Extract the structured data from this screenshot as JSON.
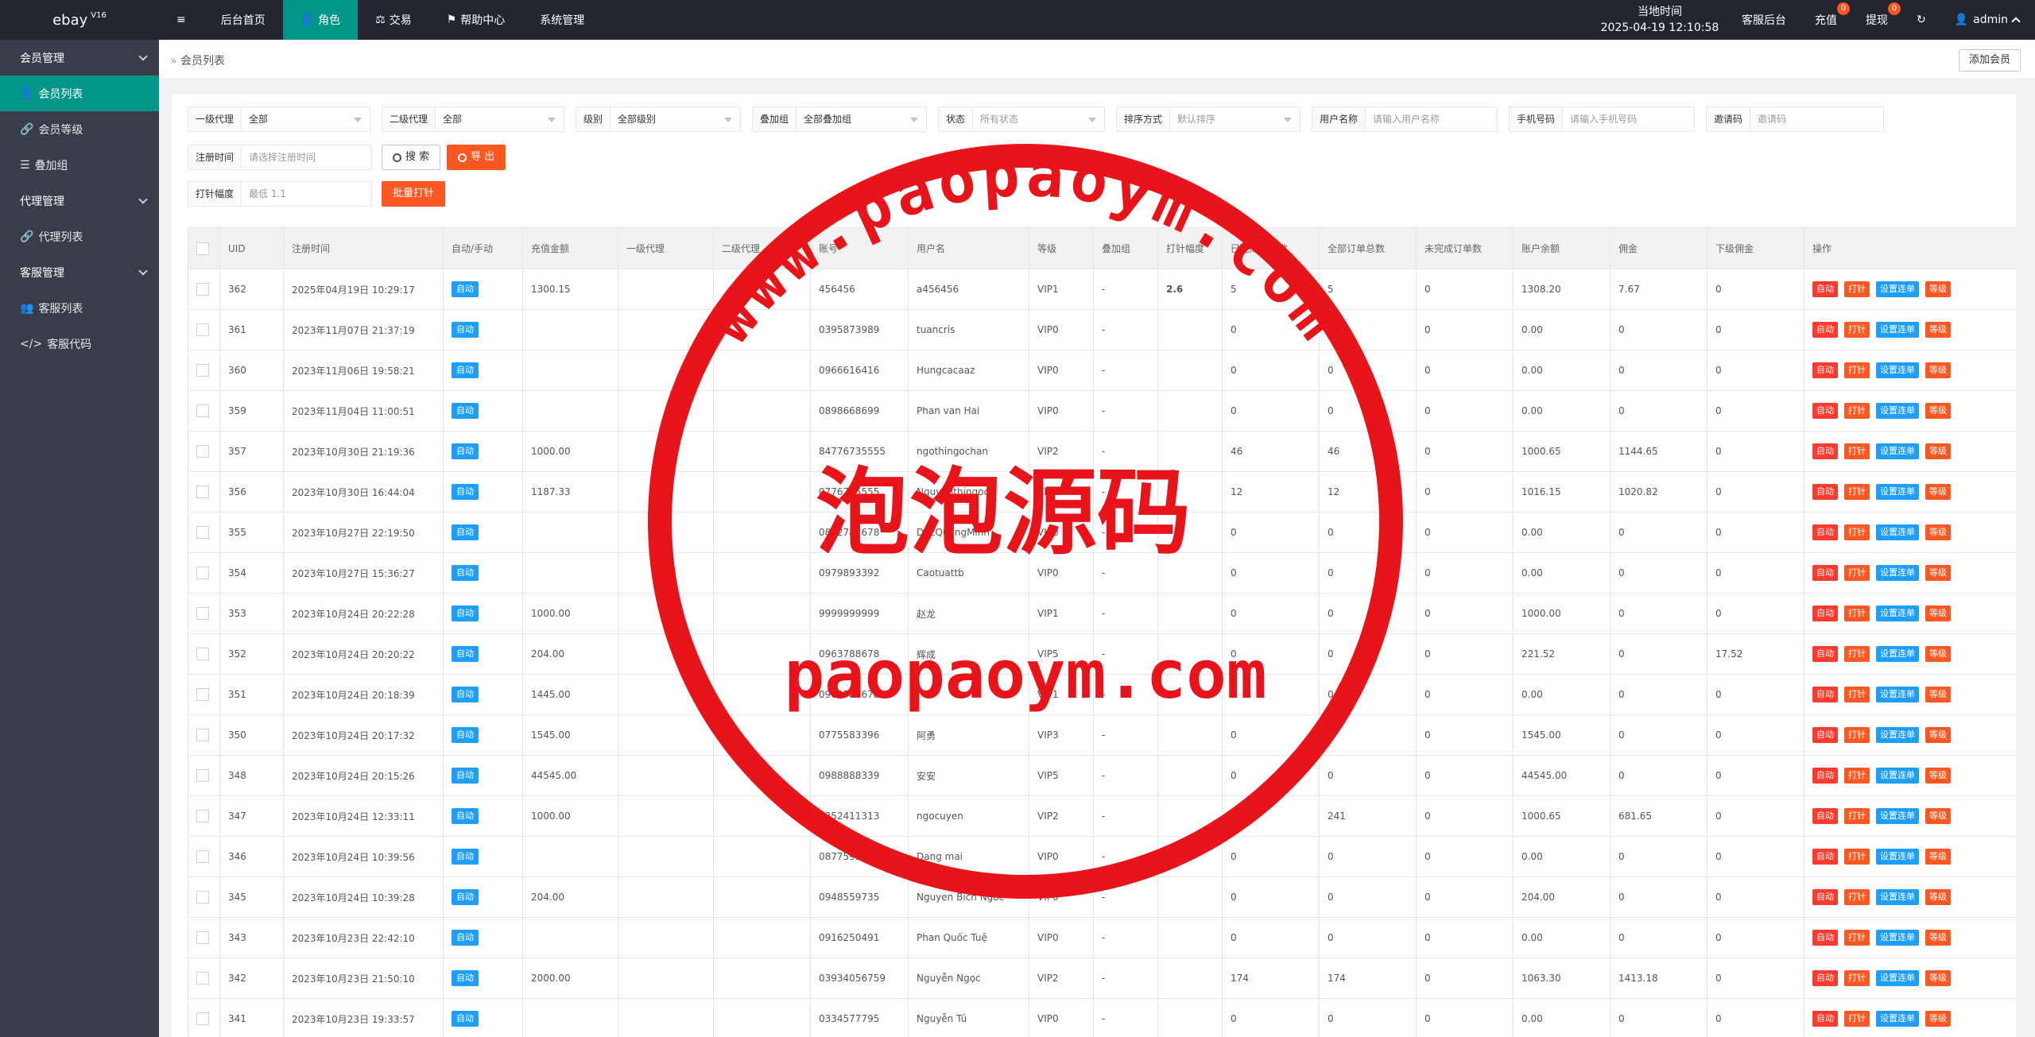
{
  "topbar": {
    "brand": "ebay",
    "brand_version": "V16",
    "menu_toggle_icon": "≡",
    "nav": [
      {
        "label": "后台首页",
        "icon": ""
      },
      {
        "label": "角色",
        "icon": "👤"
      },
      {
        "label": "交易",
        "icon": "⚖"
      },
      {
        "label": "帮助中心",
        "icon": "⚑"
      },
      {
        "label": "系统管理",
        "icon": ""
      }
    ],
    "clock_label": "当地时间",
    "clock_value": "2025-04-19 12:10:58",
    "service_backend": "客服后台",
    "recharge": "充值",
    "recharge_count": "0",
    "withdraw": "提现",
    "withdraw_count": "0",
    "refresh_icon": "↻",
    "user": "admin"
  },
  "sidebar": {
    "groups": [
      {
        "label": "会员管理",
        "items": [
          {
            "label": "会员列表",
            "icon": "👤",
            "active": true
          },
          {
            "label": "会员等级",
            "icon": "🔗"
          },
          {
            "label": "叠加组",
            "icon": "☰"
          }
        ]
      },
      {
        "label": "代理管理",
        "items": [
          {
            "label": "代理列表",
            "icon": "🔗"
          }
        ]
      },
      {
        "label": "客服管理",
        "items": [
          {
            "label": "客服列表",
            "icon": "👥"
          },
          {
            "label": "客服代码",
            "icon": "</>"
          }
        ]
      }
    ]
  },
  "tabbar": {
    "breadcrumb": "会员列表",
    "add_button": "添加会员"
  },
  "filters": {
    "agent1": {
      "label": "一级代理",
      "value": "全部"
    },
    "agent2": {
      "label": "二级代理",
      "value": "全部"
    },
    "level": {
      "label": "级别",
      "value": "全部级别"
    },
    "stack": {
      "label": "叠加组",
      "value": "全部叠加组"
    },
    "status": {
      "label": "状态",
      "placeholder": "所有状态"
    },
    "sort": {
      "label": "排序方式",
      "placeholder": "默认排序"
    },
    "username": {
      "label": "用户名称",
      "placeholder": "请输入用户名称"
    },
    "phone": {
      "label": "手机号码",
      "placeholder": "请输入手机号码"
    },
    "invite": {
      "label": "邀请码",
      "placeholder": "邀请码"
    },
    "regtime": {
      "label": "注册时间",
      "placeholder": "请选择注册时间"
    },
    "search_button": "搜 索",
    "export_button": "导 出",
    "needle": {
      "label": "打针幅度",
      "placeholder": "最低 1.1"
    },
    "batch_button": "批量打针"
  },
  "table": {
    "columns": [
      "UID",
      "注册时间",
      "自动/手动",
      "充值金额",
      "一级代理",
      "二级代理",
      "账号",
      "用户名",
      "等级",
      "叠加组",
      "打针幅度",
      "已完成订单数",
      "全部订单总数",
      "未完成订单数",
      "账户余额",
      "佣金",
      "下级佣金",
      "操作"
    ],
    "actions": [
      "自动",
      "打针",
      "设置连单",
      "等级"
    ],
    "rows": [
      {
        "uid": "362",
        "time": "2025年04月19日 10:29:17",
        "mode": "自动",
        "recharge": "1300.15",
        "a1": "",
        "a2": "",
        "account": "456456",
        "name": "a456456",
        "level": "VIP1",
        "stack": "-",
        "needle": "2.6",
        "done": "5",
        "total": "5",
        "undone": "0",
        "balance": "1308.20",
        "comm": "7.67",
        "subcomm": "0"
      },
      {
        "uid": "361",
        "time": "2023年11月07日 21:37:19",
        "mode": "自动",
        "recharge": "",
        "a1": "",
        "a2": "",
        "account": "0395873989",
        "name": "tuancris",
        "level": "VIP0",
        "stack": "-",
        "needle": "",
        "done": "0",
        "total": "0",
        "undone": "0",
        "balance": "0.00",
        "comm": "0",
        "subcomm": "0"
      },
      {
        "uid": "360",
        "time": "2023年11月06日 19:58:21",
        "mode": "自动",
        "recharge": "",
        "a1": "",
        "a2": "",
        "account": "0966616416",
        "name": "Hungcacaaz",
        "level": "VIP0",
        "stack": "-",
        "needle": "",
        "done": "0",
        "total": "0",
        "undone": "0",
        "balance": "0.00",
        "comm": "0",
        "subcomm": "0"
      },
      {
        "uid": "359",
        "time": "2023年11月04日 11:00:51",
        "mode": "自动",
        "recharge": "",
        "a1": "",
        "a2": "",
        "account": "0898668699",
        "name": "Phan van Hai",
        "level": "VIP0",
        "stack": "-",
        "needle": "",
        "done": "0",
        "total": "0",
        "undone": "0",
        "balance": "0.00",
        "comm": "0",
        "subcomm": "0"
      },
      {
        "uid": "357",
        "time": "2023年10月30日 21:19:36",
        "mode": "自动",
        "recharge": "1000.00",
        "a1": "",
        "a2": "",
        "account": "84776735555",
        "name": "ngothingochan",
        "level": "VIP2",
        "stack": "-",
        "needle": "",
        "done": "46",
        "total": "46",
        "undone": "0",
        "balance": "1000.65",
        "comm": "1144.65",
        "subcomm": "0"
      },
      {
        "uid": "356",
        "time": "2023年10月30日 16:44:04",
        "mode": "自动",
        "recharge": "1187.33",
        "a1": "",
        "a2": "",
        "account": "0776735555",
        "name": "Nguyenthingoc",
        "level": "VIP2",
        "stack": "-",
        "needle": "",
        "done": "12",
        "total": "12",
        "undone": "0",
        "balance": "1016.15",
        "comm": "1020.82",
        "subcomm": "0"
      },
      {
        "uid": "355",
        "time": "2023年10月27日 22:19:50",
        "mode": "自动",
        "recharge": "",
        "a1": "",
        "a2": "",
        "account": "0822782678",
        "name": "DucQuangMinh",
        "level": "VIP0",
        "stack": "-",
        "needle": "",
        "done": "0",
        "total": "0",
        "undone": "0",
        "balance": "0.00",
        "comm": "0",
        "subcomm": "0"
      },
      {
        "uid": "354",
        "time": "2023年10月27日 15:36:27",
        "mode": "自动",
        "recharge": "",
        "a1": "",
        "a2": "",
        "account": "0979893392",
        "name": "Caotuattb",
        "level": "VIP0",
        "stack": "-",
        "needle": "",
        "done": "0",
        "total": "0",
        "undone": "0",
        "balance": "0.00",
        "comm": "0",
        "subcomm": "0"
      },
      {
        "uid": "353",
        "time": "2023年10月24日 20:22:28",
        "mode": "自动",
        "recharge": "1000.00",
        "a1": "",
        "a2": "",
        "account": "9999999999",
        "name": "赵龙",
        "level": "VIP1",
        "stack": "-",
        "needle": "",
        "done": "0",
        "total": "0",
        "undone": "0",
        "balance": "1000.00",
        "comm": "0",
        "subcomm": "0"
      },
      {
        "uid": "352",
        "time": "2023年10月24日 20:20:22",
        "mode": "自动",
        "recharge": "204.00",
        "a1": "",
        "a2": "",
        "account": "0963788678",
        "name": "辉成",
        "level": "VIP5",
        "stack": "-",
        "needle": "",
        "done": "0",
        "total": "0",
        "undone": "0",
        "balance": "221.52",
        "comm": "0",
        "subcomm": "17.52"
      },
      {
        "uid": "351",
        "time": "2023年10月24日 20:18:39",
        "mode": "自动",
        "recharge": "1445.00",
        "a1": "",
        "a2": "",
        "account": "0963788678",
        "name": "",
        "level": "VIP1",
        "stack": "-",
        "needle": "",
        "done": "0",
        "total": "0",
        "undone": "0",
        "balance": "0.00",
        "comm": "0",
        "subcomm": "0"
      },
      {
        "uid": "350",
        "time": "2023年10月24日 20:17:32",
        "mode": "自动",
        "recharge": "1545.00",
        "a1": "",
        "a2": "",
        "account": "0775583396",
        "name": "阿勇",
        "level": "VIP3",
        "stack": "-",
        "needle": "",
        "done": "0",
        "total": "0",
        "undone": "0",
        "balance": "1545.00",
        "comm": "0",
        "subcomm": "0"
      },
      {
        "uid": "348",
        "time": "2023年10月24日 20:15:26",
        "mode": "自动",
        "recharge": "44545.00",
        "a1": "",
        "a2": "",
        "account": "0988888339",
        "name": "安安",
        "level": "VIP5",
        "stack": "-",
        "needle": "",
        "done": "0",
        "total": "0",
        "undone": "0",
        "balance": "44545.00",
        "comm": "0",
        "subcomm": "0"
      },
      {
        "uid": "347",
        "time": "2023年10月24日 12:33:11",
        "mode": "自动",
        "recharge": "1000.00",
        "a1": "",
        "a2": "",
        "account": "0352411313",
        "name": "ngocuyen",
        "level": "VIP2",
        "stack": "-",
        "needle": "",
        "done": "241",
        "total": "241",
        "undone": "0",
        "balance": "1000.65",
        "comm": "681.65",
        "subcomm": "0"
      },
      {
        "uid": "346",
        "time": "2023年10月24日 10:39:56",
        "mode": "自动",
        "recharge": "",
        "a1": "",
        "a2": "",
        "account": "0877599452",
        "name": "Dang mai",
        "level": "VIP0",
        "stack": "-",
        "needle": "",
        "done": "0",
        "total": "0",
        "undone": "0",
        "balance": "0.00",
        "comm": "0",
        "subcomm": "0"
      },
      {
        "uid": "345",
        "time": "2023年10月24日 10:39:28",
        "mode": "自动",
        "recharge": "204.00",
        "a1": "",
        "a2": "",
        "account": "0948559735",
        "name": "Nguyen Bich Ngoc",
        "level": "VIP0",
        "stack": "-",
        "needle": "",
        "done": "0",
        "total": "0",
        "undone": "0",
        "balance": "204.00",
        "comm": "0",
        "subcomm": "0"
      },
      {
        "uid": "343",
        "time": "2023年10月23日 22:42:10",
        "mode": "自动",
        "recharge": "",
        "a1": "",
        "a2": "",
        "account": "0916250491",
        "name": "Phan Quốc Tuệ",
        "level": "VIP0",
        "stack": "-",
        "needle": "",
        "done": "0",
        "total": "0",
        "undone": "0",
        "balance": "0.00",
        "comm": "0",
        "subcomm": "0"
      },
      {
        "uid": "342",
        "time": "2023年10月23日 21:50:10",
        "mode": "自动",
        "recharge": "2000.00",
        "a1": "",
        "a2": "",
        "account": "03934056759",
        "name": "Nguyễn Ngọc",
        "level": "VIP2",
        "stack": "-",
        "needle": "",
        "done": "174",
        "total": "174",
        "undone": "0",
        "balance": "1063.30",
        "comm": "1413.18",
        "subcomm": "0"
      },
      {
        "uid": "341",
        "time": "2023年10月23日 19:33:57",
        "mode": "自动",
        "recharge": "",
        "a1": "",
        "a2": "",
        "account": "0334577795",
        "name": "Nguyễn Tú",
        "level": "VIP0",
        "stack": "-",
        "needle": "",
        "done": "0",
        "total": "0",
        "undone": "0",
        "balance": "0.00",
        "comm": "0",
        "subcomm": "0"
      }
    ]
  },
  "watermark": {
    "ring_text": "www.paopaoym.com",
    "main_text": "泡泡源码",
    "sub_text": "paopaoym.com",
    "color": "#e8141a"
  }
}
